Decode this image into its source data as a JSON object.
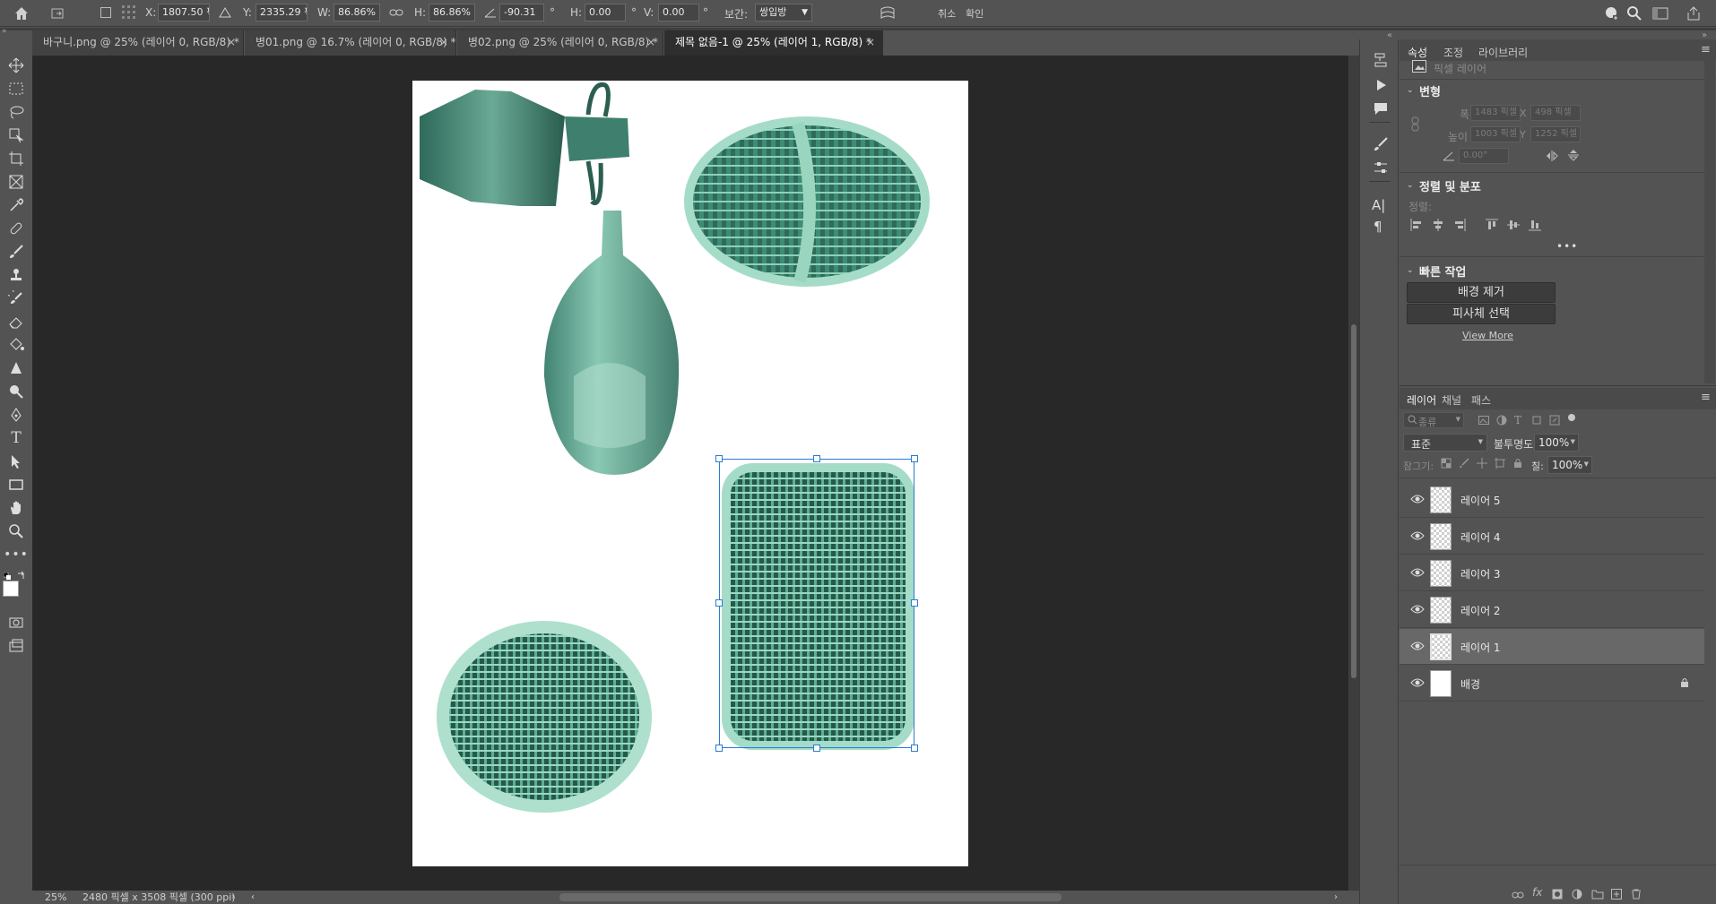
{
  "options_bar": {
    "x_label": "X:",
    "x_value": "1807.50 픽",
    "y_label": "Y:",
    "y_value": "2335.29 픽",
    "w_label": "W:",
    "w_value": "86.86%",
    "h_label": "H:",
    "h_value": "86.86%",
    "angle_value": "-90.31",
    "skew_h_label": "H:",
    "skew_h_value": "0.00",
    "skew_v_label": "V:",
    "skew_v_value": "0.00",
    "degree": "°",
    "interp_label": "보간:",
    "interp_value": "쌍입방",
    "cancel_label": "취소",
    "confirm_label": "확인"
  },
  "tabs": [
    {
      "label": "바구니.png @ 25% (레이어 0, RGB/8) *"
    },
    {
      "label": "병01.png @ 16.7% (레이어 0, RGB/8) *"
    },
    {
      "label": "병02.png @ 25% (레이어 0, RGB/8) *"
    },
    {
      "label": "제목 없음-1 @ 25% (레이어 1, RGB/8) *"
    }
  ],
  "status": {
    "zoom": "25%",
    "doc_info": "2480 픽셀 x 3508 픽셀 (300 ppi)"
  },
  "properties": {
    "tabs": [
      "속성",
      "조정",
      "라이브러리"
    ],
    "kind": "픽셀 레이어",
    "transform": {
      "title": "변형",
      "width_label": "폭",
      "width_value": "1483 픽셀",
      "height_label": "높이",
      "height_value": "1003 픽셀",
      "x_label": "X",
      "x_value": "498 픽셀",
      "y_label": "Y",
      "y_value": "1252 픽셀",
      "angle_value": "0.00°"
    },
    "align": {
      "title": "정렬 및 분포",
      "sub_label": "정렬:"
    },
    "quick": {
      "title": "빠른 작업",
      "remove_bg": "배경 제거",
      "select_subject": "피사체 선택",
      "view_more": "View More"
    }
  },
  "layers_panel": {
    "tabs": [
      "레이어",
      "채널",
      "패스"
    ],
    "filter_placeholder": "종류",
    "blend_mode": "표준",
    "opacity_label": "불투명도:",
    "opacity_value": "100%",
    "lock_label": "잠그기:",
    "fill_label": "칠:",
    "fill_value": "100%",
    "layers": [
      {
        "name": "레이어 5"
      },
      {
        "name": "레이어 4"
      },
      {
        "name": "레이어 3"
      },
      {
        "name": "레이어 2"
      },
      {
        "name": "레이어 1"
      },
      {
        "name": "배경"
      }
    ]
  }
}
